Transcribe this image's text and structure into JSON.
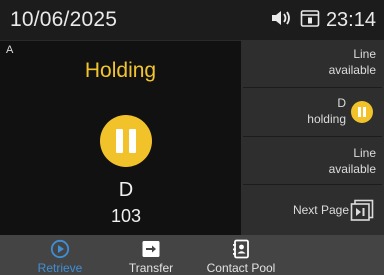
{
  "status": {
    "date": "10/06/2025",
    "time": "23:14"
  },
  "call": {
    "line": "A",
    "state": "Holding",
    "name": "D",
    "number": "103"
  },
  "lines": [
    {
      "line1": "Line",
      "line2": "available"
    },
    {
      "line1": "D",
      "line2": "holding"
    },
    {
      "line1": "Line",
      "line2": "available"
    }
  ],
  "next_page": "Next Page",
  "softkeys": [
    {
      "label": "Retrieve",
      "icon": "play-circle-icon"
    },
    {
      "label": "Transfer",
      "icon": "transfer-icon"
    },
    {
      "label": "Contact Pool",
      "icon": "contact-book-icon"
    }
  ],
  "colors": {
    "hold_yellow": "#f2c22a",
    "active_blue": "#3f8fd6",
    "background": "#111111",
    "softkey_bar": "#444444"
  }
}
